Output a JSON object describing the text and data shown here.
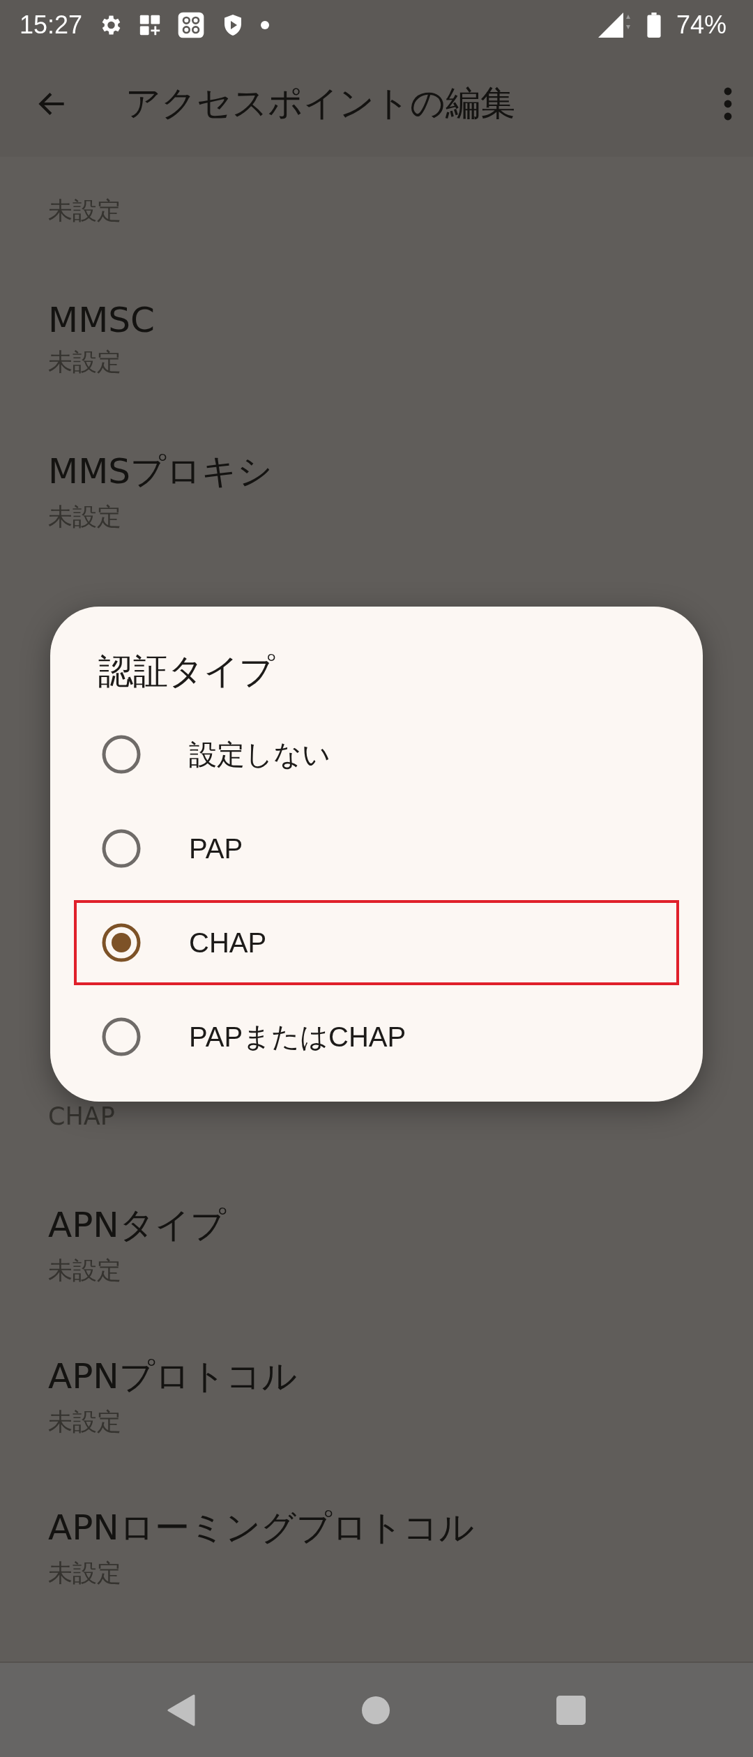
{
  "status_bar": {
    "time": "15:27",
    "battery": "74%"
  },
  "app_bar": {
    "title": "アクセスポイントの編集"
  },
  "settings_above": [
    {
      "value": "未設定"
    },
    {
      "title": "MMSC",
      "value": "未設定"
    },
    {
      "title": "MMSプロキシ",
      "value": "未設定"
    }
  ],
  "settings_below": [
    {
      "value": "CHAP"
    },
    {
      "title": "APNタイプ",
      "value": "未設定"
    },
    {
      "title": "APNプロトコル",
      "value": "未設定"
    },
    {
      "title": "APNローミングプロトコル",
      "value": "未設定"
    }
  ],
  "dialog": {
    "title": "認証タイプ",
    "options": [
      {
        "label": "設定しない",
        "selected": false,
        "highlighted": false
      },
      {
        "label": "PAP",
        "selected": false,
        "highlighted": false
      },
      {
        "label": "CHAP",
        "selected": true,
        "highlighted": true
      },
      {
        "label": "PAPまたはCHAP",
        "selected": false,
        "highlighted": false
      }
    ]
  }
}
